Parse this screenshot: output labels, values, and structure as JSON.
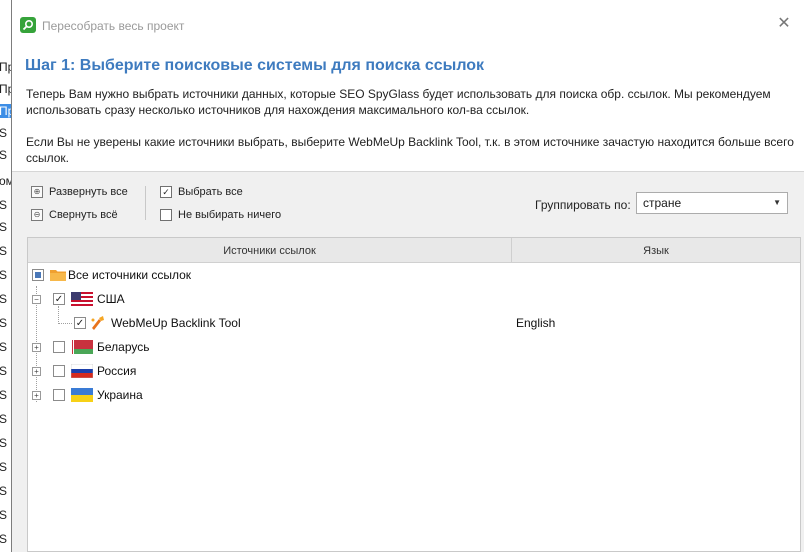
{
  "window": {
    "title": "Пересобрать весь проект"
  },
  "background_app": {
    "rows": [
      "Пр",
      "Пр",
      "Пр",
      "S",
      "S",
      "ом",
      "S",
      "S",
      "S",
      "S",
      "S",
      "S",
      "S",
      "S",
      "S",
      "S",
      "S",
      "S",
      "S",
      "S",
      "S",
      "S"
    ]
  },
  "header": {
    "title": "Шаг 1: Выберите поисковые системы для поиска ссылок",
    "paragraph1": "Теперь Вам нужно выбрать источники данных, которые SEO SpyGlass будет использовать для поиска обр. ссылок. Мы рекомендуем использовать сразу несколько источников для нахождения максимального кол-ва ссылок.",
    "paragraph2": "Если Вы не уверены какие источники выбрать, выберите WebMeUp Backlink Tool, т.к. в этом источнике зачастую находится больше всего ссылок."
  },
  "toolbar": {
    "expand_all": "Развернуть все",
    "collapse_all": "Свернуть всё",
    "select_all": "Выбрать все",
    "select_none": "Не выбирать ничего",
    "group_by_label": "Группировать по:",
    "group_by_value": "стране"
  },
  "table": {
    "columns": [
      "Источники ссылок",
      "Язык"
    ],
    "root": {
      "label": "Все источники ссылок"
    },
    "countries": [
      {
        "label": "США",
        "checked": true,
        "expanded": true,
        "flag": "us-flag",
        "children": [
          {
            "label": "WebMeUp Backlink Tool",
            "language": "English",
            "checked": true
          }
        ]
      },
      {
        "label": "Беларусь",
        "checked": false,
        "expanded": false,
        "flag": "by-flag"
      },
      {
        "label": "Россия",
        "checked": false,
        "expanded": false,
        "flag": "ru-flag"
      },
      {
        "label": "Украина",
        "checked": false,
        "expanded": false,
        "flag": "ua-flag"
      }
    ]
  },
  "colors": {
    "accent_title": "#3e7bbf",
    "app_icon": "#36a33a"
  }
}
